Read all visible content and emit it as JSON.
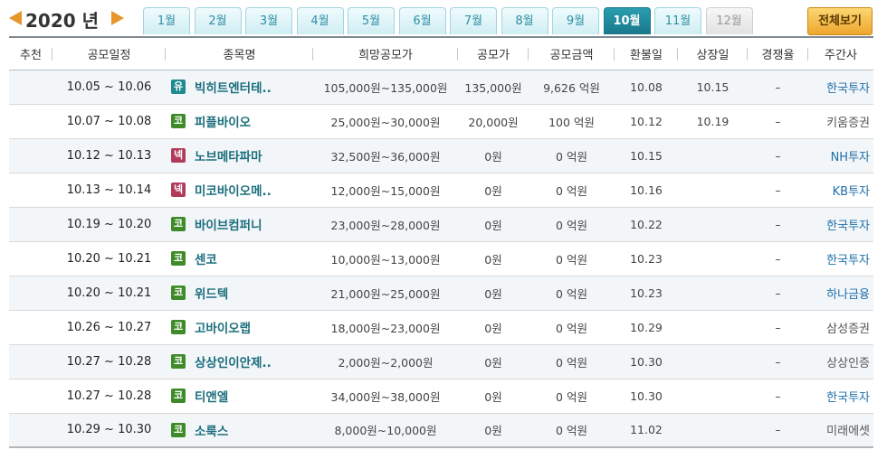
{
  "year_label": "2020 년",
  "months": [
    {
      "label": "1월",
      "state": "normal"
    },
    {
      "label": "2월",
      "state": "normal"
    },
    {
      "label": "3월",
      "state": "normal"
    },
    {
      "label": "4월",
      "state": "normal"
    },
    {
      "label": "5월",
      "state": "normal"
    },
    {
      "label": "6월",
      "state": "normal"
    },
    {
      "label": "7월",
      "state": "normal"
    },
    {
      "label": "8월",
      "state": "normal"
    },
    {
      "label": "9월",
      "state": "normal"
    },
    {
      "label": "10월",
      "state": "active"
    },
    {
      "label": "11월",
      "state": "normal"
    },
    {
      "label": "12월",
      "state": "disabled"
    }
  ],
  "all_view_label": "전체보기",
  "colors": {
    "accent": "#1b6e7d",
    "badge_kospi": "#1f8a8f",
    "badge_kosdaq": "#3f8b2a",
    "badge_konex": "#b03b5b",
    "link_blue": "#1e6fa8"
  },
  "columns": [
    "추천",
    "공모일정",
    "종목명",
    "희망공모가",
    "공모가",
    "공모금액",
    "환불일",
    "상장일",
    "경쟁율",
    "주간사"
  ],
  "rows": [
    {
      "rec": "",
      "date": "10.05 ~ 10.06",
      "badge": "유",
      "badge_type": "kospi",
      "name": "빅히트엔터테..",
      "range": "105,000원~135,000원",
      "price": "135,000원",
      "amount": "9,626 억원",
      "refund": "10.08",
      "listing": "10.15",
      "competition": "–",
      "manager": "한국투자",
      "manager_link": true
    },
    {
      "rec": "",
      "date": "10.07 ~ 10.08",
      "badge": "코",
      "badge_type": "kosdaq",
      "name": "피플바이오",
      "range": "25,000원~30,000원",
      "price": "20,000원",
      "amount": "100 억원",
      "refund": "10.12",
      "listing": "10.19",
      "competition": "–",
      "manager": "키움증권",
      "manager_link": false
    },
    {
      "rec": "",
      "date": "10.12 ~ 10.13",
      "badge": "넥",
      "badge_type": "konex",
      "name": "노브메타파마",
      "range": "32,500원~36,000원",
      "price": "0원",
      "amount": "0 억원",
      "refund": "10.15",
      "listing": "",
      "competition": "–",
      "manager": "NH투자",
      "manager_link": true
    },
    {
      "rec": "",
      "date": "10.13 ~ 10.14",
      "badge": "넥",
      "badge_type": "konex",
      "name": "미코바이오메..",
      "range": "12,000원~15,000원",
      "price": "0원",
      "amount": "0 억원",
      "refund": "10.16",
      "listing": "",
      "competition": "–",
      "manager": "KB투자",
      "manager_link": true
    },
    {
      "rec": "",
      "date": "10.19 ~ 10.20",
      "badge": "코",
      "badge_type": "kosdaq",
      "name": "바이브컴퍼니",
      "range": "23,000원~28,000원",
      "price": "0원",
      "amount": "0 억원",
      "refund": "10.22",
      "listing": "",
      "competition": "–",
      "manager": "한국투자",
      "manager_link": true
    },
    {
      "rec": "",
      "date": "10.20 ~ 10.21",
      "badge": "코",
      "badge_type": "kosdaq",
      "name": "센코",
      "range": "10,000원~13,000원",
      "price": "0원",
      "amount": "0 억원",
      "refund": "10.23",
      "listing": "",
      "competition": "–",
      "manager": "한국투자",
      "manager_link": true
    },
    {
      "rec": "",
      "date": "10.20 ~ 10.21",
      "badge": "코",
      "badge_type": "kosdaq",
      "name": "위드텍",
      "range": "21,000원~25,000원",
      "price": "0원",
      "amount": "0 억원",
      "refund": "10.23",
      "listing": "",
      "competition": "–",
      "manager": "하나금융",
      "manager_link": true
    },
    {
      "rec": "",
      "date": "10.26 ~ 10.27",
      "badge": "코",
      "badge_type": "kosdaq",
      "name": "고바이오랩",
      "range": "18,000원~23,000원",
      "price": "0원",
      "amount": "0 억원",
      "refund": "10.29",
      "listing": "",
      "competition": "–",
      "manager": "삼성증권",
      "manager_link": false
    },
    {
      "rec": "",
      "date": "10.27 ~ 10.28",
      "badge": "코",
      "badge_type": "kosdaq",
      "name": "상상인이안제..",
      "range": "2,000원~2,000원",
      "price": "0원",
      "amount": "0 억원",
      "refund": "10.30",
      "listing": "",
      "competition": "–",
      "manager": "상상인증",
      "manager_link": false
    },
    {
      "rec": "",
      "date": "10.27 ~ 10.28",
      "badge": "코",
      "badge_type": "kosdaq",
      "name": "티앤엘",
      "range": "34,000원~38,000원",
      "price": "0원",
      "amount": "0 억원",
      "refund": "10.30",
      "listing": "",
      "competition": "–",
      "manager": "한국투자",
      "manager_link": true
    },
    {
      "rec": "",
      "date": "10.29 ~ 10.30",
      "badge": "코",
      "badge_type": "kosdaq",
      "name": "소룩스",
      "range": "8,000원~10,000원",
      "price": "0원",
      "amount": "0 억원",
      "refund": "11.02",
      "listing": "",
      "competition": "–",
      "manager": "미래에셋",
      "manager_link": false
    }
  ]
}
